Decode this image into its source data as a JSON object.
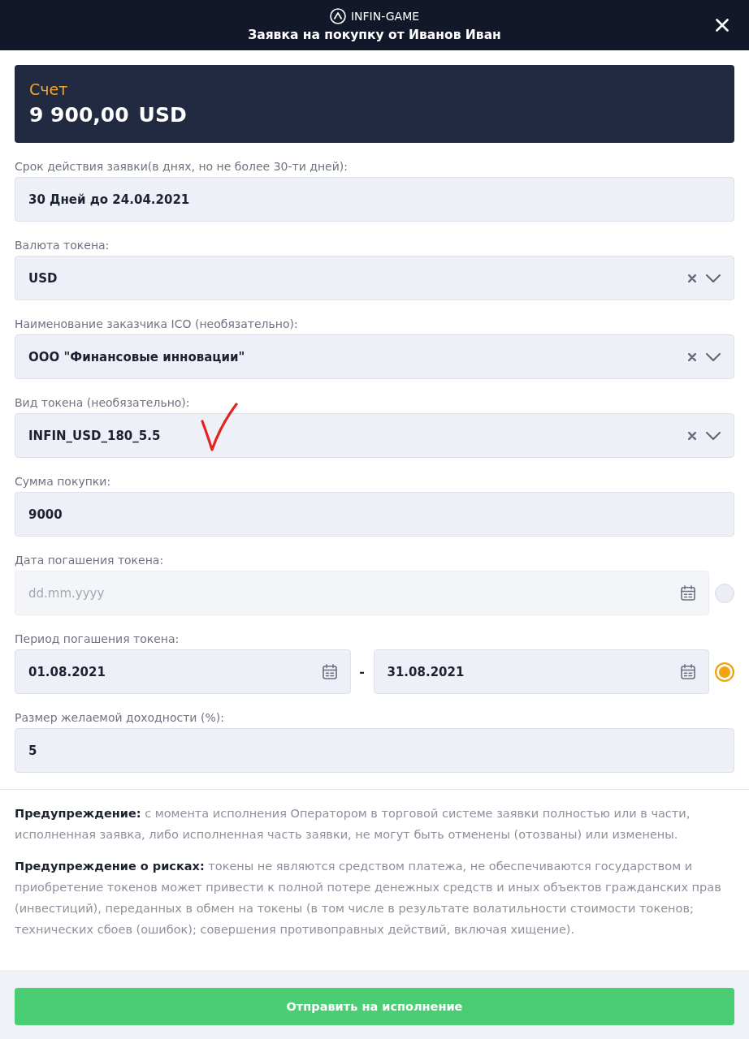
{
  "header": {
    "brand": "INFIN-GAME",
    "title": "Заявка на покупку от Иванов Иван"
  },
  "account": {
    "label": "Счет",
    "amount": "9 900,00",
    "currency": "USD"
  },
  "fields": [
    {
      "kind": "text",
      "label": "Срок действия заявки(в днях, но не более 30-ти дней):",
      "value": "30 Дней до 24.04.2021"
    },
    {
      "kind": "select",
      "label": "Валюта токена:",
      "value": "USD"
    },
    {
      "kind": "select",
      "label": "Наименование заказчика ICO (необязательно):",
      "value": "ООО \"Финансовые инновации\""
    },
    {
      "kind": "select",
      "label": "Вид токена (необязательно):",
      "value": "INFIN_USD_180_5.5"
    },
    {
      "kind": "text",
      "label": "Сумма покупки:",
      "value": "9000"
    },
    {
      "kind": "date",
      "label": "Дата погашения токена:",
      "placeholder": "dd.mm.yyyy",
      "disabled": true,
      "selected": false
    },
    {
      "kind": "date_range",
      "label": "Период погашения токена:",
      "from": "01.08.2021",
      "separator": "-",
      "to": "31.08.2021",
      "disabled": false,
      "selected": true
    },
    {
      "kind": "text",
      "label": "Размер желаемой доходности (%):",
      "value": "5"
    }
  ],
  "warnings": [
    "**Предупреждение:** с момента исполнения Оператором в торговой системе заявки полностью или в части, исполненная заявка, либо исполненная часть заявки, не могут быть отменены (отозваны) или изменены.",
    "**Предупреждение о рисках:** токены не являются средством платежа, не обеспечиваются государством и приобретение токенов может привести к полной потере денежных средств и иных объектов гражданских прав (инвестиций), переданных в обмен на токены (в том числе в результате волатильности стоимости токенов; технических сбоев (ошибок); совершения противоправных действий, включая хищение)."
  ],
  "submit_button": "Отправить на исполнение"
}
